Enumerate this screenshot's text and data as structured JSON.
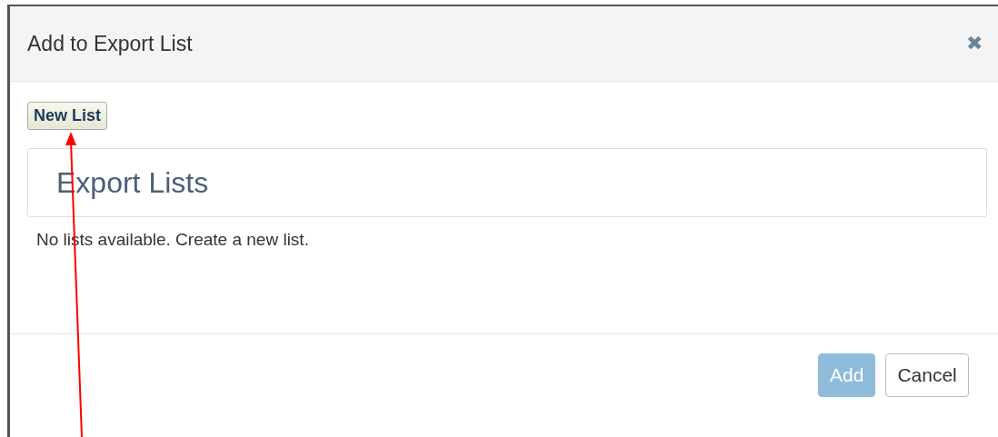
{
  "dialog": {
    "title": "Add to Export List",
    "close": "✖"
  },
  "new_list_button": {
    "label": "New List"
  },
  "panel": {
    "heading": "Export Lists"
  },
  "message": "No lists available. Create a new list.",
  "buttons": [
    {
      "label": "Add",
      "kind": "primary",
      "disabled": true
    },
    {
      "label": "Cancel",
      "kind": "default",
      "disabled": false
    }
  ],
  "annotation": {
    "kind": "arrow"
  }
}
